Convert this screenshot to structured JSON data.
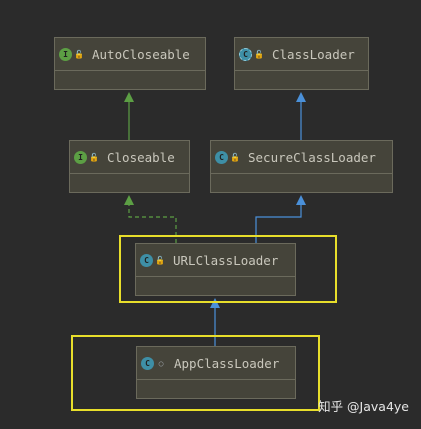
{
  "nodes": [
    {
      "id": "autocloseable",
      "label": "AutoCloseable",
      "kind": "interface",
      "badge": "I",
      "visibility": "public"
    },
    {
      "id": "classloader",
      "label": "ClassLoader",
      "kind": "abstract-class",
      "badge": "C",
      "visibility": "public"
    },
    {
      "id": "closeable",
      "label": "Closeable",
      "kind": "interface",
      "badge": "I",
      "visibility": "public"
    },
    {
      "id": "secureclassloader",
      "label": "SecureClassLoader",
      "kind": "class",
      "badge": "C",
      "visibility": "public"
    },
    {
      "id": "urlclassloader",
      "label": "URLClassLoader",
      "kind": "class",
      "badge": "C",
      "visibility": "public"
    },
    {
      "id": "appclassloader",
      "label": "AppClassLoader",
      "kind": "class",
      "badge": "C",
      "visibility": "package-private"
    }
  ],
  "edges": [
    {
      "from": "closeable",
      "to": "autocloseable",
      "type": "extends",
      "color": "#5c9f44",
      "style": "solid"
    },
    {
      "from": "secureclassloader",
      "to": "classloader",
      "type": "extends",
      "color": "#4a90d9",
      "style": "solid"
    },
    {
      "from": "urlclassloader",
      "to": "closeable",
      "type": "implements",
      "color": "#5c9f44",
      "style": "dashed"
    },
    {
      "from": "urlclassloader",
      "to": "secureclassloader",
      "type": "extends",
      "color": "#4a90d9",
      "style": "solid"
    },
    {
      "from": "appclassloader",
      "to": "urlclassloader",
      "type": "extends",
      "color": "#4a90d9",
      "style": "solid"
    }
  ],
  "highlighted": [
    "urlclassloader",
    "appclassloader"
  ],
  "watermark": "知乎 @Java4ye",
  "colors": {
    "background": "#2b2b2b",
    "node_fill": "#45443a",
    "node_border": "#6b6a5c",
    "highlight": "#e8de2b",
    "interface_arrow": "#5c9f44",
    "class_arrow": "#4a90d9"
  }
}
